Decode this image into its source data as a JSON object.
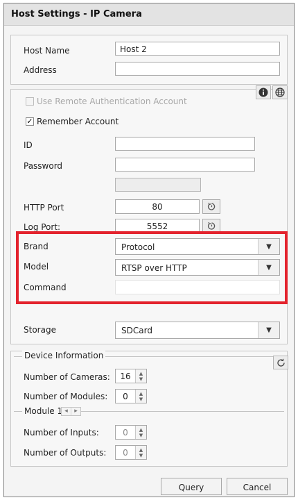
{
  "window": {
    "title": "Host Settings - IP Camera"
  },
  "host": {
    "host_name_label": "Host Name",
    "host_name_value": "Host 2",
    "address_label": "Address",
    "address_value": ""
  },
  "auth": {
    "use_remote_label": "Use Remote Authentication Account",
    "remember_label": "Remember Account",
    "remember_check": "✓",
    "id_label": "ID",
    "id_value": "",
    "password_label": "Password",
    "password_value": "",
    "info_icon": "info-icon",
    "globe_icon": "globe-icon"
  },
  "ports": {
    "http_label": "HTTP Port",
    "http_value": "80",
    "log_label": "Log Port:",
    "log_value": "5552",
    "reset_icon": "reset-icon"
  },
  "protocol": {
    "brand_label": "Brand",
    "brand_value": "Protocol",
    "model_label": "Model",
    "model_value": "RTSP over HTTP",
    "command_label": "Command",
    "command_value": "",
    "highlight_color": "#e3232d"
  },
  "storage": {
    "label": "Storage",
    "value": "SDCard"
  },
  "device_info": {
    "title": "Device Information",
    "refresh_icon": "refresh-icon",
    "cameras_label": "Number of Cameras:",
    "cameras_value": "16",
    "modules_label": "Number of Modules:",
    "modules_value": "0",
    "module_title": "Module 1",
    "module_prev": "◂",
    "module_next": "▸",
    "inputs_label": "Number of Inputs:",
    "inputs_value": "0",
    "outputs_label": "Number of Outputs:",
    "outputs_value": "0"
  },
  "actions": {
    "query_label": "Query",
    "cancel_label": "Cancel"
  }
}
